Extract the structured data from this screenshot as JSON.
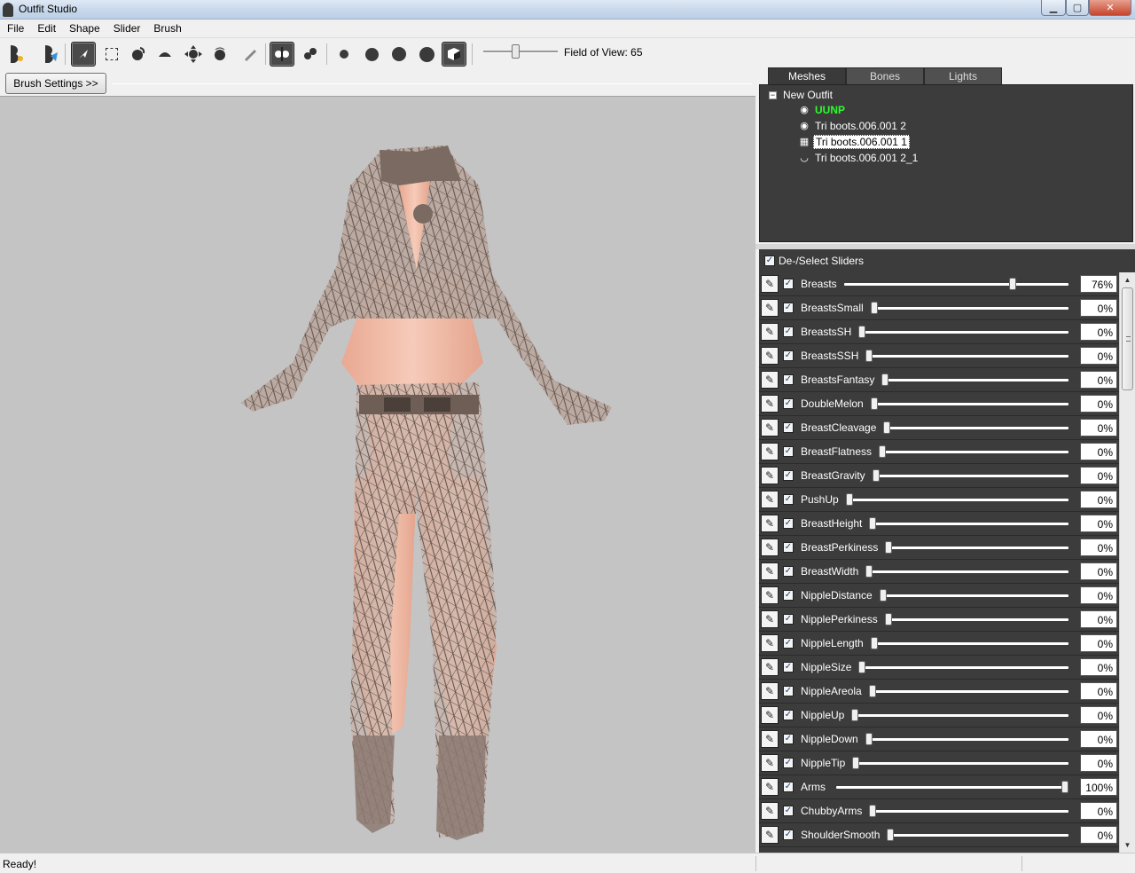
{
  "window": {
    "title": "Outfit Studio",
    "min_glyph": "▁",
    "max_glyph": "▢",
    "close_glyph": "✕"
  },
  "menu": [
    "File",
    "Edit",
    "Shape",
    "Slider",
    "Brush"
  ],
  "toolbar": {
    "field_of_view_label": "Field of View: 65",
    "field_of_view_value": 65,
    "tools": [
      "load-project-icon",
      "save-project-icon",
      "select-icon",
      "mask-brush-icon",
      "inflate-brush-icon",
      "deflate-brush-icon",
      "move-brush-icon",
      "smooth-brush-icon",
      "weight-brush-icon",
      "x-mirror-icon",
      "connected-only-icon",
      "brush-size-1-icon",
      "brush-size-2-icon",
      "brush-size-3-icon",
      "brush-size-4-icon",
      "cube-view-icon"
    ]
  },
  "brush_settings_label": "Brush Settings >>",
  "tabs": [
    {
      "label": "Meshes",
      "active": true
    },
    {
      "label": "Bones",
      "active": false
    },
    {
      "label": "Lights",
      "active": false
    }
  ],
  "mesh_tree": {
    "root": "New Outfit",
    "expander": "−",
    "items": [
      {
        "label": "UUNP",
        "icon": "eye-icon",
        "glyph": "◉",
        "reference": true,
        "selected": false
      },
      {
        "label": "Tri boots.006.001 2",
        "icon": "eye-icon",
        "glyph": "◉",
        "reference": false,
        "selected": false
      },
      {
        "label": "Tri boots.006.001 1",
        "icon": "wireframe-grid-icon",
        "glyph": "▦",
        "reference": false,
        "selected": true
      },
      {
        "label": "Tri boots.006.001 2_1",
        "icon": "hidden-eye-icon",
        "glyph": "◡",
        "reference": false,
        "selected": false
      }
    ]
  },
  "deselect_label": "De-/Select Sliders",
  "check_glyph": "✓",
  "edit_glyph": "✎",
  "sliders": [
    {
      "name": "Breasts",
      "value": 76,
      "display": "76%"
    },
    {
      "name": "BreastsSmall",
      "value": 0,
      "display": "0%"
    },
    {
      "name": "BreastsSH",
      "value": 0,
      "display": "0%"
    },
    {
      "name": "BreastsSSH",
      "value": 0,
      "display": "0%"
    },
    {
      "name": "BreastsFantasy",
      "value": 0,
      "display": "0%"
    },
    {
      "name": "DoubleMelon",
      "value": 0,
      "display": "0%"
    },
    {
      "name": "BreastCleavage",
      "value": 0,
      "display": "0%"
    },
    {
      "name": "BreastFlatness",
      "value": 0,
      "display": "0%"
    },
    {
      "name": "BreastGravity",
      "value": 0,
      "display": "0%"
    },
    {
      "name": "PushUp",
      "value": 0,
      "display": "0%"
    },
    {
      "name": "BreastHeight",
      "value": 0,
      "display": "0%"
    },
    {
      "name": "BreastPerkiness",
      "value": 0,
      "display": "0%"
    },
    {
      "name": "BreastWidth",
      "value": 0,
      "display": "0%"
    },
    {
      "name": "NippleDistance",
      "value": 0,
      "display": "0%"
    },
    {
      "name": "NipplePerkiness",
      "value": 0,
      "display": "0%"
    },
    {
      "name": "NippleLength",
      "value": 0,
      "display": "0%"
    },
    {
      "name": "NippleSize",
      "value": 0,
      "display": "0%"
    },
    {
      "name": "NippleAreola",
      "value": 0,
      "display": "0%"
    },
    {
      "name": "NippleUp",
      "value": 0,
      "display": "0%"
    },
    {
      "name": "NippleDown",
      "value": 0,
      "display": "0%"
    },
    {
      "name": "NippleTip",
      "value": 0,
      "display": "0%"
    },
    {
      "name": "Arms",
      "value": 100,
      "display": "100%"
    },
    {
      "name": "ChubbyArms",
      "value": 0,
      "display": "0%"
    },
    {
      "name": "ShoulderSmooth",
      "value": 0,
      "display": "0%"
    }
  ],
  "scroll_up_glyph": "▲",
  "scroll_down_glyph": "▼",
  "status": "Ready!",
  "colors": {
    "viewport_bg": "#c4c4c4",
    "panel_bg": "#3c3c3c",
    "reference_mesh": "#2aff2a",
    "skin": "#e8b4a0",
    "outfit_wire": "#6a5a52"
  }
}
